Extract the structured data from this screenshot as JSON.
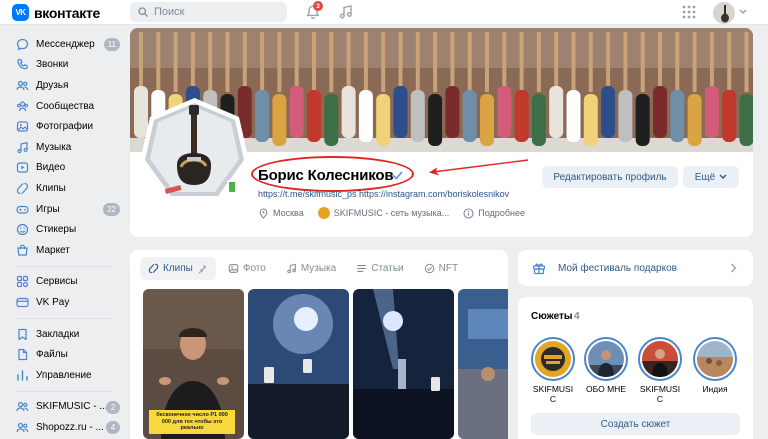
{
  "header": {
    "logo_text": "вконтакте",
    "logo_mark": "VK",
    "search_placeholder": "Поиск",
    "notifications_count": "3"
  },
  "sidebar": {
    "items": [
      {
        "label": "Мессенджер",
        "icon": "message-icon",
        "count": "11"
      },
      {
        "label": "Звонки",
        "icon": "phone-icon"
      },
      {
        "label": "Друзья",
        "icon": "friends-icon"
      },
      {
        "label": "Сообщества",
        "icon": "communities-icon"
      },
      {
        "label": "Фотографии",
        "icon": "photo-icon"
      },
      {
        "label": "Музыка",
        "icon": "music-icon"
      },
      {
        "label": "Видео",
        "icon": "video-icon"
      },
      {
        "label": "Клипы",
        "icon": "clips-icon"
      },
      {
        "label": "Игры",
        "icon": "games-icon",
        "count": "22"
      },
      {
        "label": "Стикеры",
        "icon": "stickers-icon"
      },
      {
        "label": "Маркет",
        "icon": "market-icon"
      }
    ],
    "items2": [
      {
        "label": "Сервисы",
        "icon": "services-icon"
      },
      {
        "label": "VK Pay",
        "icon": "vkpay-icon"
      }
    ],
    "items3": [
      {
        "label": "Закладки",
        "icon": "bookmark-icon"
      },
      {
        "label": "Файлы",
        "icon": "file-icon"
      },
      {
        "label": "Управление",
        "icon": "manage-icon"
      }
    ],
    "items4": [
      {
        "label": "SKIFMUSIC - ...",
        "icon": "group-icon",
        "count": "2"
      },
      {
        "label": "Shopozz.ru - ...",
        "icon": "group-icon",
        "count": "4"
      }
    ]
  },
  "profile": {
    "name": "Борис Колесников",
    "links": "https://t.me/skifmusic_ps https://instagram.com/boriskolesnikov",
    "city": "Москва",
    "community": "SKIFMUSIC - сеть музыка...",
    "details": "Подробнее",
    "edit_button": "Редактировать профиль",
    "more_button": "Ещё"
  },
  "content_tabs": [
    {
      "label": "Клипы",
      "icon": "clips-icon",
      "active": true
    },
    {
      "label": "Фото",
      "icon": "photo-icon"
    },
    {
      "label": "Музыка",
      "icon": "music-icon"
    },
    {
      "label": "Статьи",
      "icon": "article-icon"
    },
    {
      "label": "NFT",
      "icon": "nft-icon"
    }
  ],
  "clips": {
    "caption": "бесконечное число Р1 000 000 для тех чтобы это реально"
  },
  "gifts": {
    "label": "Мой фестиваль подарков"
  },
  "stories": {
    "title": "Сюжеты",
    "count": "4",
    "items": [
      {
        "label": "SKIFMUSI C"
      },
      {
        "label": "ОБО МНЕ"
      },
      {
        "label": "SKIFMUSI C"
      },
      {
        "label": "Индия"
      }
    ],
    "create_button": "Создать сюжет"
  },
  "colors": {
    "accent": "#0077ff",
    "link": "#2c5a8b",
    "annotation": "#e32322",
    "online": "#4bb34b"
  }
}
